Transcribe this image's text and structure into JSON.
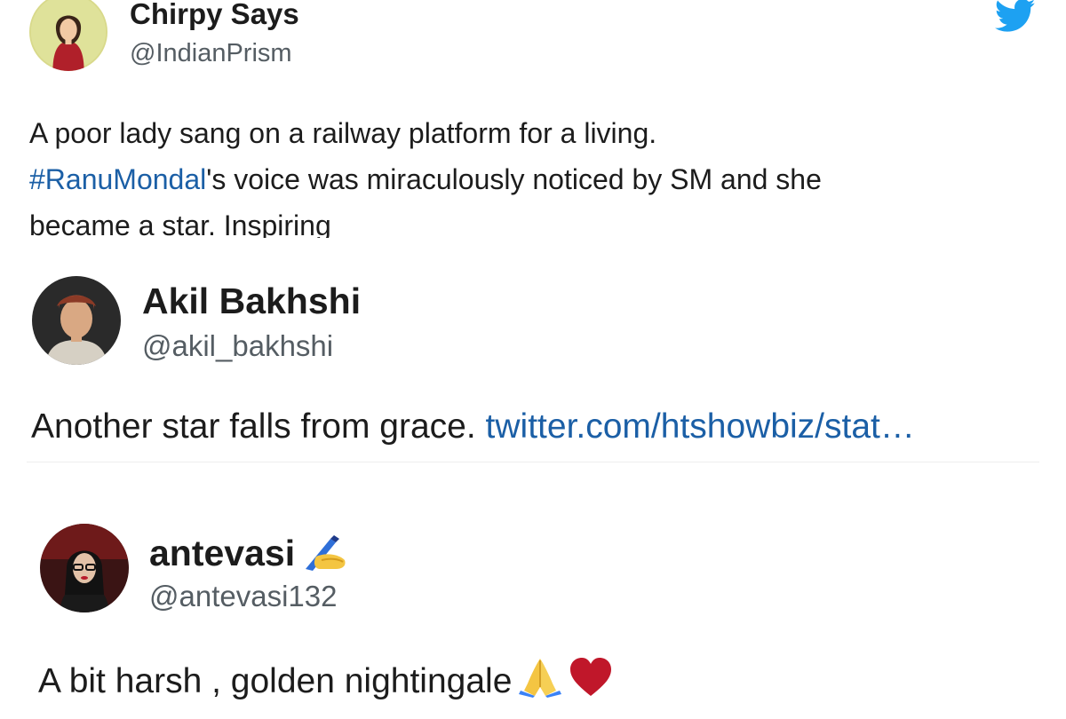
{
  "tweets": [
    {
      "display_name": "Chirpy Says",
      "handle": "@IndianPrism",
      "body_line1": "A poor lady sang on a railway platform for a living.",
      "body_hashtag": "#RanuMondal",
      "body_line2_rest": "'s voice was miraculously noticed by SM and she",
      "body_line3": "became a star. Inspiring"
    },
    {
      "display_name": "Akil Bakhshi",
      "handle": "@akil_bakhshi",
      "body_text": "Another star falls from grace.",
      "body_link": "twitter.com/htshowbiz/stat…"
    },
    {
      "display_name": "antevasi",
      "name_emoji": "writing-hand-icon",
      "handle": "@antevasi132",
      "body_text": "A bit harsh , golden nightingale",
      "body_emojis": [
        "folded-hands-icon",
        "red-heart-icon"
      ]
    }
  ],
  "colors": {
    "link": "#1b5fa6",
    "twitter_brand": "#1da1f2",
    "handle_gray": "#555d63",
    "heart_red": "#c0172a"
  }
}
